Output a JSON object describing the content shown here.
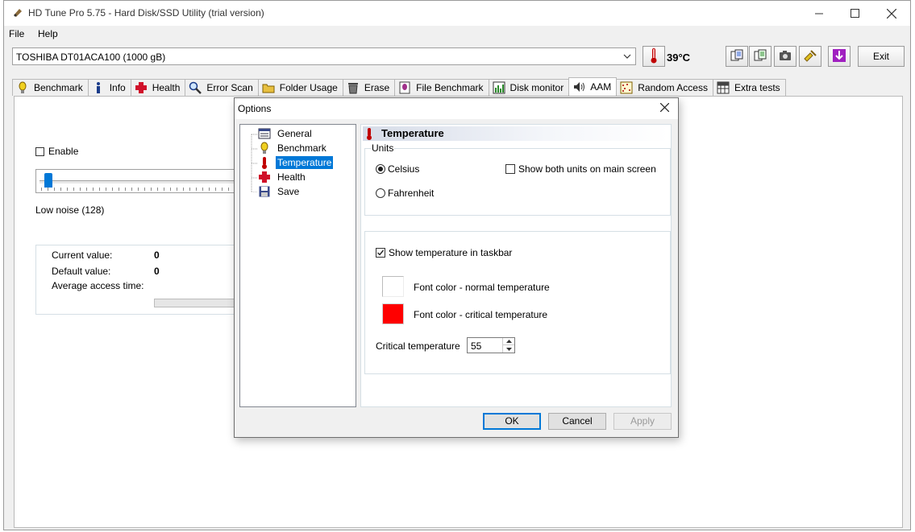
{
  "app": {
    "title": "HD Tune Pro 5.75 - Hard Disk/SSD Utility (trial version)",
    "window_controls": [
      "minimize-icon",
      "maximize-icon",
      "close-icon"
    ]
  },
  "menu": {
    "items": [
      "File",
      "Help"
    ]
  },
  "toolbar": {
    "drive": "TOSHIBA DT01ACA100 (1000 gB)",
    "temperature": "39°C",
    "buttons": [
      "copy-text-icon",
      "copy-info-icon",
      "screenshot-icon",
      "options-icon",
      "save-icon"
    ],
    "exit_label": "Exit"
  },
  "tabs": [
    {
      "label": "Benchmark",
      "icon": "benchmark-icon"
    },
    {
      "label": "Info",
      "icon": "info-icon"
    },
    {
      "label": "Health",
      "icon": "health-icon"
    },
    {
      "label": "Error Scan",
      "icon": "error-scan-icon"
    },
    {
      "label": "Folder Usage",
      "icon": "folder-icon"
    },
    {
      "label": "Erase",
      "icon": "erase-icon"
    },
    {
      "label": "File Benchmark",
      "icon": "file-benchmark-icon"
    },
    {
      "label": "Disk monitor",
      "icon": "disk-monitor-icon"
    },
    {
      "label": "AAM",
      "icon": "speaker-icon",
      "active": true
    },
    {
      "label": "Random Access",
      "icon": "random-access-icon"
    },
    {
      "label": "Extra tests",
      "icon": "extra-tests-icon"
    }
  ],
  "aam": {
    "enable_label": "Enable",
    "enable_checked": false,
    "slider_level_label": "Low noise (128)",
    "slider_position": 0,
    "current_value_label": "Current value:",
    "current_value": "0",
    "default_value_label": "Default value:",
    "default_value": "0",
    "avg_access_label": "Average access time:"
  },
  "dialog": {
    "title": "Options",
    "tree": [
      {
        "label": "General",
        "icon": "general-icon"
      },
      {
        "label": "Benchmark",
        "icon": "benchmark-icon"
      },
      {
        "label": "Temperature",
        "icon": "thermometer-icon",
        "selected": true
      },
      {
        "label": "Health",
        "icon": "health-icon"
      },
      {
        "label": "Save",
        "icon": "save-icon"
      }
    ],
    "page_title": "Temperature",
    "units_group": "Units",
    "celsius_label": "Celsius",
    "celsius_selected": true,
    "fahrenheit_label": "Fahrenheit",
    "both_units_label": "Show both units on main screen",
    "both_units_checked": false,
    "taskbar_label": "Show temperature in taskbar",
    "taskbar_checked": true,
    "normal_color_label": "Font color - normal temperature",
    "normal_color": "#ffffff",
    "critical_color_label": "Font color - critical temperature",
    "critical_color": "#ff0000",
    "critical_temp_label": "Critical temperature",
    "critical_temp_value": "55",
    "ok_label": "OK",
    "cancel_label": "Cancel",
    "apply_label": "Apply"
  },
  "colors": {
    "selection": "#0078d7",
    "thermometer": "#c00000",
    "health_cross": "#d0102a"
  }
}
